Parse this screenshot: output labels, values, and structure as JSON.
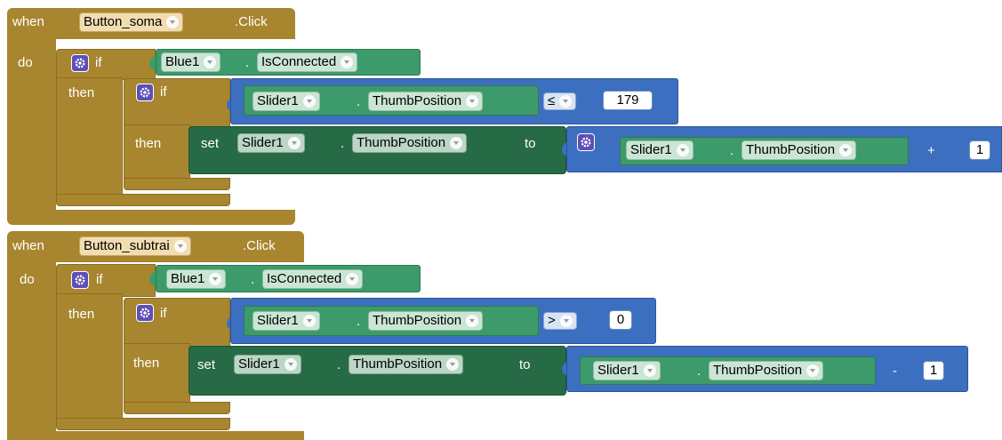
{
  "colors": {
    "event": "#a8862f",
    "logic": "#3d6fc0",
    "component": "#3d9a6a",
    "setter": "#266b45"
  },
  "blocks": [
    {
      "when": "when",
      "button": "Button_soma",
      "event": ".Click",
      "do": "do",
      "if1": {
        "kw": "if",
        "then": "then",
        "comp": "Blue1",
        "dot": ".",
        "prop": "IsConnected"
      },
      "if2": {
        "kw": "if",
        "then": "then",
        "comp": "Slider1",
        "dot": ".",
        "prop": "ThumbPosition",
        "op": "≤",
        "num": "179"
      },
      "set": {
        "kw": "set",
        "comp": "Slider1",
        "dot": ".",
        "prop": "ThumbPosition",
        "to": "to",
        "rcomp": "Slider1",
        "rdot": ".",
        "rprop": "ThumbPosition",
        "mathop": "+",
        "num": "1"
      }
    },
    {
      "when": "when",
      "button": "Button_subtrai",
      "event": ".Click",
      "do": "do",
      "if1": {
        "kw": "if",
        "then": "then",
        "comp": "Blue1",
        "dot": ".",
        "prop": "IsConnected"
      },
      "if2": {
        "kw": "if",
        "then": "then",
        "comp": "Slider1",
        "dot": ".",
        "prop": "ThumbPosition",
        "op": ">",
        "num": "0"
      },
      "set": {
        "kw": "set",
        "comp": "Slider1",
        "dot": ".",
        "prop": "ThumbPosition",
        "to": "to",
        "rcomp": "Slider1",
        "rdot": ".",
        "rprop": "ThumbPosition",
        "mathop": "-",
        "num": "1"
      }
    }
  ]
}
